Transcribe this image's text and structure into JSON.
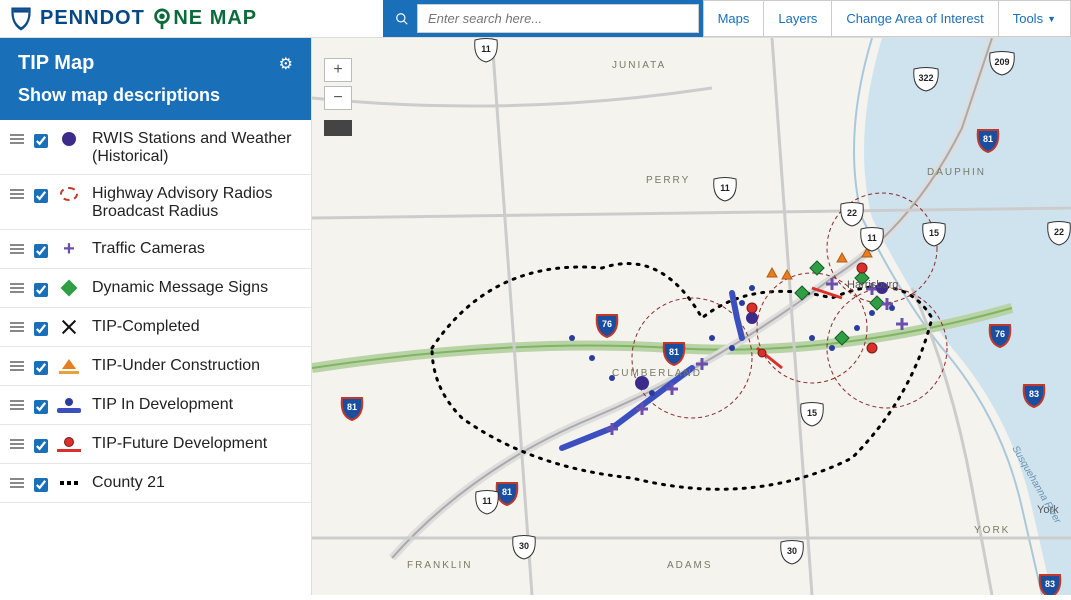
{
  "logo": {
    "p1": "PENND",
    "p2": "O",
    "p3": "T ",
    "p4": "NE MAP"
  },
  "search": {
    "placeholder": "Enter search here..."
  },
  "nav": {
    "maps": "Maps",
    "layers": "Layers",
    "area": "Change Area of Interest",
    "tools": "Tools"
  },
  "sidebar": {
    "title": "TIP Map",
    "subtitle": "Show map descriptions",
    "layers": [
      {
        "label": "RWIS Stations and Weather (Historical)"
      },
      {
        "label": "Highway Advisory Radios Broadcast Radius"
      },
      {
        "label": "Traffic Cameras"
      },
      {
        "label": "Dynamic Message Signs"
      },
      {
        "label": "TIP-Completed"
      },
      {
        "label": "TIP-Under Construction"
      },
      {
        "label": "TIP In Development"
      },
      {
        "label": "TIP-Future Development"
      },
      {
        "label": "County 21"
      }
    ]
  },
  "map": {
    "counties": [
      "JUNIATA",
      "PERRY",
      "DAUPHIN",
      "CUMBERLAND",
      "FRANKLIN",
      "ADAMS",
      "YORK"
    ],
    "cities": [
      "Harrisburg",
      "York"
    ],
    "shields": {
      "interstate": [
        "76",
        "76",
        "81",
        "81",
        "81",
        "83",
        "83",
        "81"
      ],
      "us": [
        "22",
        "11",
        "322",
        "11",
        "11",
        "15",
        "30",
        "30",
        "209",
        "11",
        "15",
        "22"
      ]
    }
  }
}
